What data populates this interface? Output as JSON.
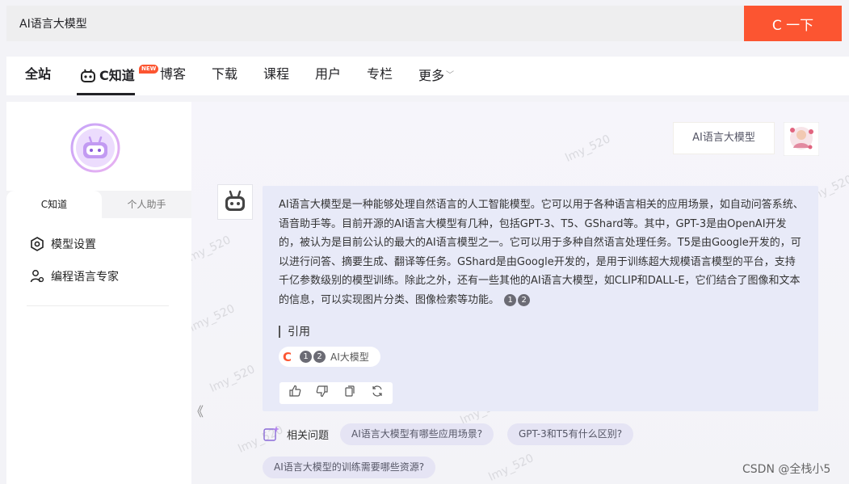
{
  "search": {
    "value": "AI语言大模型",
    "button_label": "C 一下"
  },
  "nav": {
    "tabs": [
      "全站",
      "C知道",
      "博客",
      "下载",
      "课程",
      "用户",
      "专栏",
      "更多"
    ],
    "badge": "NEW"
  },
  "sidebar": {
    "tabs": [
      "C知道",
      "个人助手"
    ],
    "items": [
      "模型设置",
      "编程语言专家"
    ]
  },
  "chat": {
    "question": "AI语言大模型",
    "answer": "AI语言大模型是一种能够处理自然语言的人工智能模型。它可以用于各种语言相关的应用场景，如自动问答系统、语音助手等。目前开源的AI语言大模型有几种，包括GPT-3、T5、GShard等。其中，GPT-3是由OpenAI开发的，被认为是目前公认的最大的AI语言模型之一。它可以用于多种自然语言处理任务。T5是由Google开发的，可以进行问答、摘要生成、翻译等任务。GShard是由Google开发的，是用于训练超大规模语言模型的平台，支持千亿参数级别的模型训练。除此之外，还有一些其他的AI语言大模型，如CLIP和DALL-E，它们结合了图像和文本的信息，可以实现图片分类、图像检索等功能。",
    "refs": [
      "1",
      "2"
    ],
    "citation_heading": "引用",
    "citation_chip": {
      "icon_letter": "C",
      "label": "AI大模型"
    }
  },
  "related": {
    "label": "相关问题",
    "questions": [
      "AI语言大模型有哪些应用场景?",
      "GPT-3和T5有什么区别?",
      "AI语言大模型的训练需要哪些资源?"
    ]
  },
  "watermark": "lmy_520",
  "footer_credit": "CSDN @全栈小5",
  "colors": {
    "accent": "#fc5531",
    "answer_bg": "#e8eaf8"
  }
}
